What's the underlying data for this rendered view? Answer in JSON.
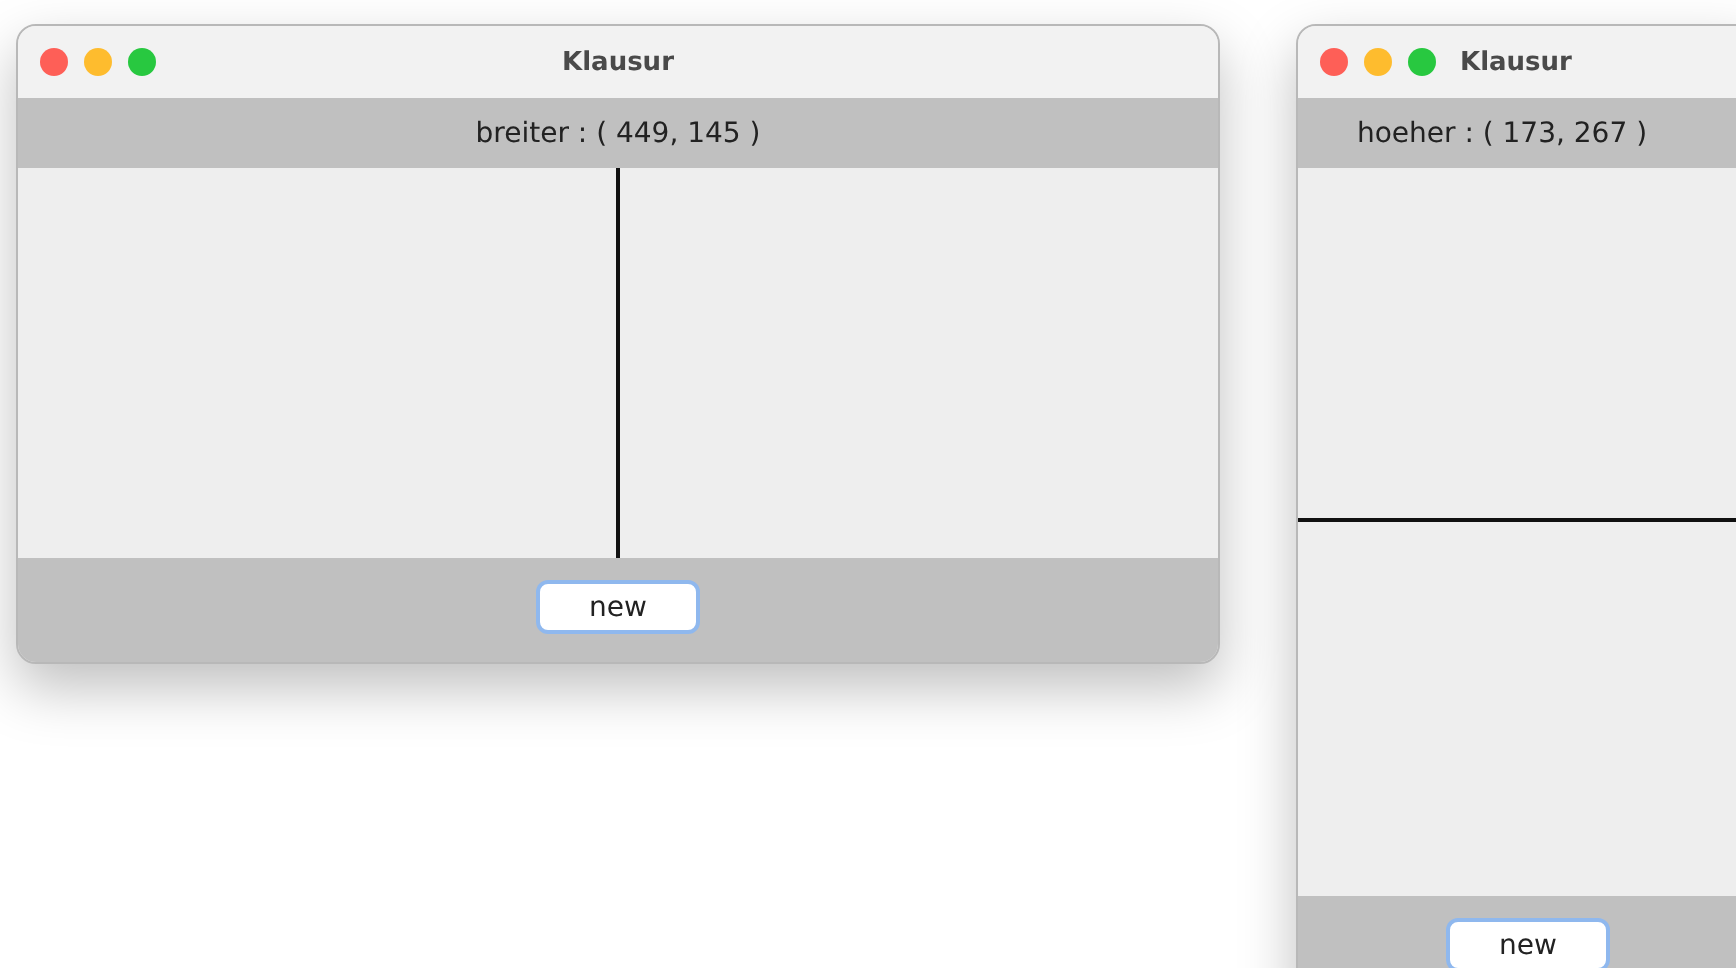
{
  "windows": [
    {
      "kind": "vertical",
      "title": "Klausur",
      "status": "breiter : ( 449, 145 )",
      "button": "new"
    },
    {
      "kind": "horizontal",
      "title": "Klausur",
      "status": "hoeher : ( 173, 267 )",
      "button": "new"
    }
  ]
}
